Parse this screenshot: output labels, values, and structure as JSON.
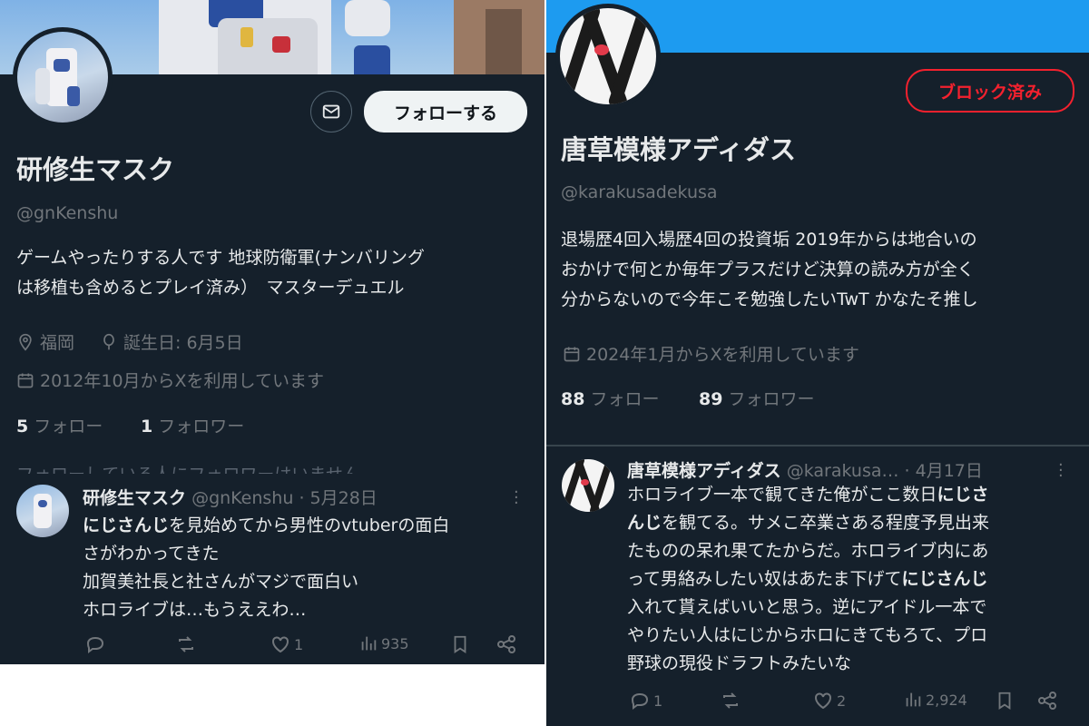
{
  "left_profile": {
    "name": "研修生マスク",
    "handle": "@gnKenshu",
    "follow_label": "フォローする",
    "bio_line1": "ゲームやったりする人です 地球防衛軍(ナンバリング",
    "bio_line2": "は移植も含めるとプレイ済み）　マスターデュエル",
    "location": "福岡",
    "birthday": "誕生日: 6月5日",
    "joined": "2012年10月からXを利用しています",
    "following_count": "5",
    "following_label": "フォロー",
    "followers_count": "1",
    "followers_label": "フォロワー",
    "cutoff_text": "フォローしている人にフォロワーはいません"
  },
  "left_tweet": {
    "name": "研修生マスク",
    "handle": "@gnKenshu",
    "date": "· 5月28日",
    "line1_bold": "にじさんじ",
    "line1_rest": "を見始めてから男性のvtuberの面白",
    "line2": "さがわかってきた",
    "line3": "加賀美社長と社さんがマジで面白い",
    "line4": "ホロライブは…もうええわ…",
    "likes": "1",
    "views": "935"
  },
  "right_profile": {
    "name": "唐草模様アディダス",
    "handle": "@karakusadekusa",
    "blocked_label": "ブロック済み",
    "bio_line1": "退場歴4回入場歴4回の投資垢 2019年からは地合いの",
    "bio_line2": "おかけで何とか毎年プラスだけど決算の読み方が全く",
    "bio_line3": "分からないので今年こそ勉強したいTwT かなたそ推し",
    "joined": "2024年1月からXを利用しています",
    "following_count": "88",
    "following_label": "フォロー",
    "followers_count": "89",
    "followers_label": "フォロワー"
  },
  "right_tweet": {
    "name": "唐草模様アディダス",
    "handle": "@karakusa…",
    "date": "· 4月17日",
    "l1_a": "ホロライブ一本で観てきた俺がここ数日",
    "l1_b": "にじさ",
    "l2_a": "んじ",
    "l2_b": "を観てる。サメこ卒業さある程度予見出来",
    "l3": "たものの呆れ果てたからだ。ホロライブ内にあ",
    "l4_a": "って男絡みしたい奴はあたま下げて",
    "l4_b": "にじさんじ",
    "l5": "入れて貰えばいいと思う。逆にアイドル一本で",
    "l6": "やりたい人はにじからホロにきてもろて、プロ",
    "l7": "野球の現役ドラフトみたいな",
    "replies": "1",
    "likes": "2",
    "views": "2,924"
  },
  "colors": {
    "background": "#15202b",
    "accent_blue": "#1d9bf0",
    "blocked_red": "#f4212e",
    "muted": "#71767b"
  }
}
